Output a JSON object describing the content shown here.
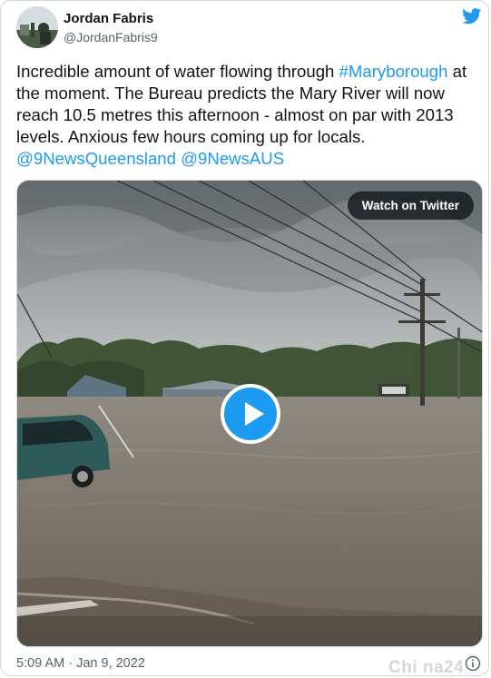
{
  "author": {
    "name": "Jordan Fabris",
    "handle": "@JordanFabris9"
  },
  "tweet": {
    "text_part1": "Incredible amount of water flowing through ",
    "hashtag": "#Maryborough",
    "text_part2": " at the moment. The Bureau predicts the Mary River will now reach 10.5 metres this afternoon - almost on par with 2013 levels. Anxious few hours coming up for locals. ",
    "mention1": "@9NewsQueensland",
    "mention2": "@9NewsAUS"
  },
  "media": {
    "watch_label": "Watch on Twitter"
  },
  "footer": {
    "timestamp": "5:09 AM · Jan 9, 2022"
  },
  "watermark": "Chi na24",
  "icons": {
    "brand": "twitter-bird-icon",
    "info": "info-icon",
    "play": "play-icon"
  },
  "colors": {
    "link": "#1d9bf0",
    "text": "#0f1419",
    "muted": "#536471",
    "border": "#cfd9de"
  }
}
